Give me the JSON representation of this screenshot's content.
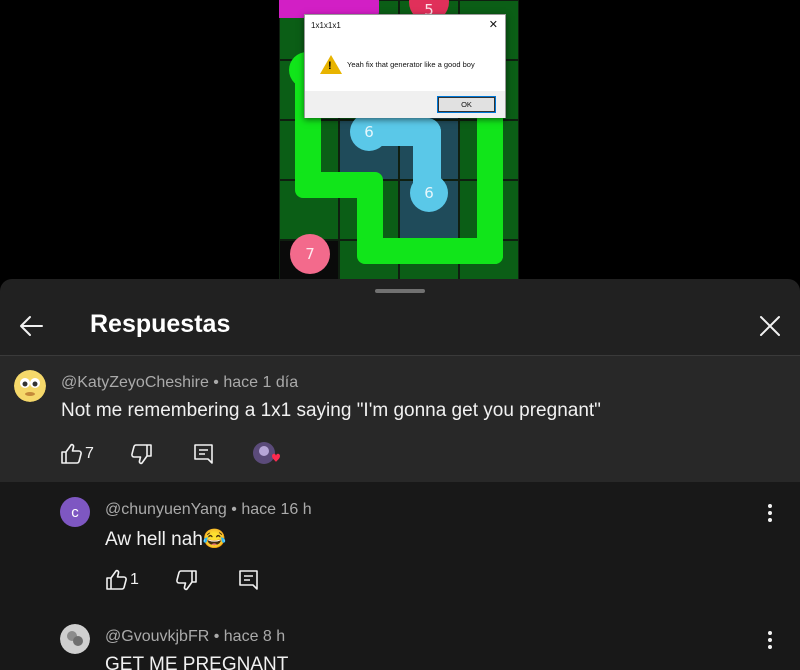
{
  "dialog": {
    "title": "1x1x1x1",
    "message": "Yeah fix that generator like a good boy",
    "ok_label": "OK",
    "close_glyph": "✕"
  },
  "game": {
    "top_number": "5",
    "mid_number_a": "6",
    "mid_number_b": "6",
    "bottom_number": "7"
  },
  "sheet": {
    "title": "Respuestas"
  },
  "parent_comment": {
    "author": "@KatyZeyoCheshire",
    "time": "hace 1 día",
    "text": "Not me remembering a 1x1 saying \"I'm gonna get you pregnant\"",
    "likes": "7"
  },
  "replies": [
    {
      "author": "@chunyuenYang",
      "time": "hace 16 h",
      "text": "Aw hell nah😂",
      "likes": "1",
      "avatar_letter": "c"
    },
    {
      "author": "@GvouvkjbFR",
      "time": "hace 8 h",
      "text": "GET ME PREGNANT"
    }
  ],
  "separator": " • ",
  "colors": {
    "sheet_bg": "#212121",
    "highlight_bg": "#282828",
    "pipe_green": "#11e51a",
    "pipe_blue": "#5ac8e8",
    "dot_pink": "#f36a8c",
    "avatar_purple": "#7e57c2"
  }
}
